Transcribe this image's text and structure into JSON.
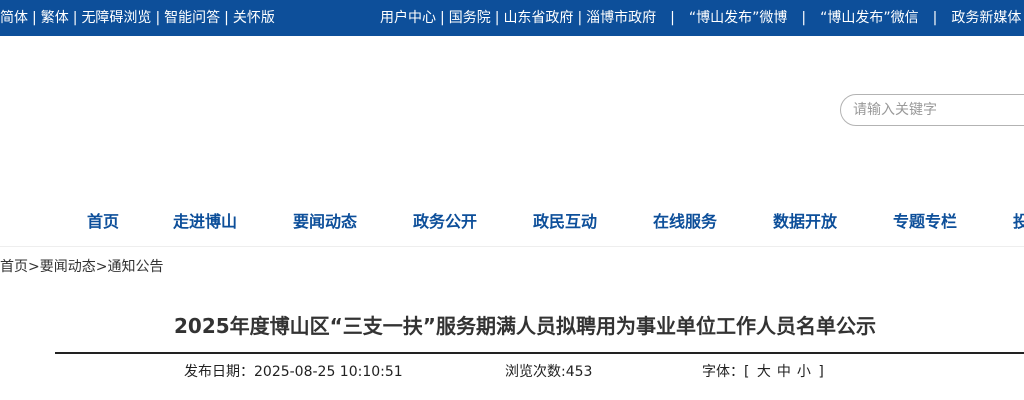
{
  "topbar": {
    "left_links": [
      "简体",
      "繁体",
      "无障碍浏览",
      "智能问答",
      "关怀版"
    ],
    "right_links": [
      "用户中心",
      "国务院",
      "山东省政府",
      "淄博市政府",
      "“博山发布”微博",
      "“博山发布”微信",
      "政务新媒体"
    ],
    "separator": "|"
  },
  "search": {
    "placeholder": "请输入关键字"
  },
  "nav": {
    "items": [
      "首页",
      "走进博山",
      "要闻动态",
      "政务公开",
      "政民互动",
      "在线服务",
      "数据开放",
      "专题专栏",
      "投资博山"
    ]
  },
  "breadcrumb": {
    "items": [
      "首页",
      "要闻动态",
      "通知公告"
    ],
    "separator": ">"
  },
  "article": {
    "title": "2025年度博山区“三支一扶”服务期满人员拟聘用为事业单位工作人员名单公示",
    "publish_label": "发布日期：",
    "publish_date": "2025-08-25 10:10:51",
    "views_label": "浏览次数:",
    "views": "453",
    "font_label": "字体：",
    "font_bracket_open": "[",
    "font_options": [
      "大",
      "中",
      "小"
    ],
    "font_bracket_close": "]"
  },
  "colors": {
    "brand_blue": "#0d4f9a",
    "text": "#333333"
  }
}
